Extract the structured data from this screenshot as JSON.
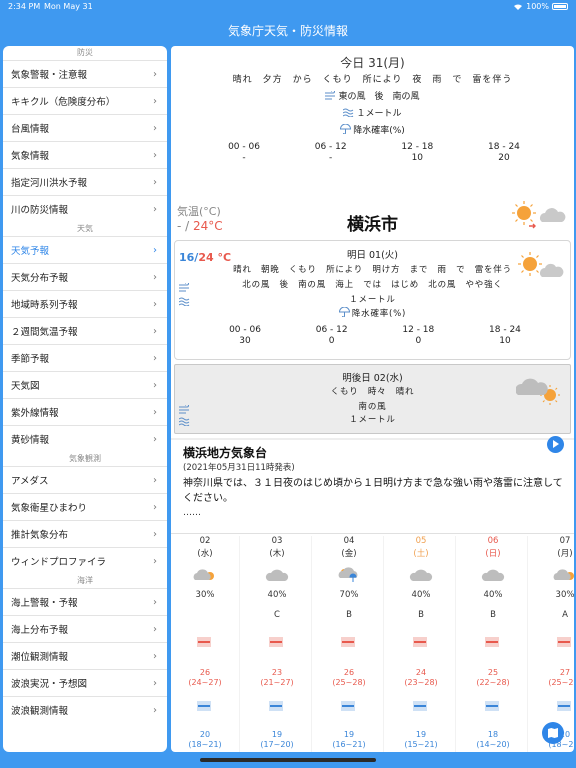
{
  "status": {
    "time": "2:34 PM",
    "date": "Mon May 31",
    "battery": "100%"
  },
  "nav": {
    "title": "気象庁天気・防災情報"
  },
  "sidebar": {
    "sections": [
      {
        "header": "防災",
        "items": [
          "気象警報・注意報",
          "キキクル（危険度分布）",
          "台風情報",
          "気象情報",
          "指定河川洪水予報",
          "川の防災情報"
        ]
      },
      {
        "header": "天気",
        "items": [
          "天気予報",
          "天気分布予報",
          "地域時系列予報",
          "２週間気温予報",
          "季節予報",
          "天気図",
          "紫外線情報",
          "黄砂情報"
        ]
      },
      {
        "header": "気象観測",
        "items": [
          "アメダス",
          "気象衛星ひまわり",
          "推計気象分布",
          "ウィンドプロファイラ"
        ]
      },
      {
        "header": "海洋",
        "items": [
          "海上警報・予報",
          "海上分布予報",
          "潮位観測情報",
          "波浪実況・予想図",
          "波浪観測情報"
        ]
      }
    ],
    "active": "天気予報",
    "chevron": "›"
  },
  "today": {
    "title": "今日  31(月)",
    "weather": "晴れ　夕方　から　くもり　所により　夜　雨　で　雷を伴う",
    "wind": "東の風　後　南の風",
    "wave": "１メートル",
    "pop_label": "降水確率(%)",
    "pop_periods": [
      "00 - 06",
      "06 - 12",
      "12 - 18",
      "18 - 24"
    ],
    "pop_values": [
      "-",
      "-",
      "10",
      "20"
    ],
    "temp_label": "気温(°C)",
    "temp_low": "- / ",
    "temp_high": "24°C",
    "city": "横浜市"
  },
  "tomorrow": {
    "title": "明日  01(火)",
    "temp_low": "16/",
    "temp_high": "24 °C",
    "weather": "晴れ　朝晩　くもり　所により　明け方　まで　雨　で　雷を伴う",
    "wind": "北の風　後　南の風　海上　では　はじめ　北の風　やや強く",
    "wave": "１メートル",
    "pop_label": "降水確率(%)",
    "pop_periods": [
      "00 - 06",
      "06 - 12",
      "12 - 18",
      "18 - 24"
    ],
    "pop_values": [
      "30",
      "0",
      "0",
      "10"
    ]
  },
  "dayafter": {
    "title": "明後日  02(水)",
    "weather": "くもり　時々　晴れ",
    "wind": "南の風",
    "wave": "１メートル"
  },
  "observatory": {
    "title": "横浜地方気象台",
    "date": "(2021年05月31日11時発表)",
    "text": "神奈川県では、３１日夜のはじめ頃から１日明け方まで急な強い雨や落雷に注意してください。",
    "more": "……"
  },
  "weekly": [
    {
      "date": "02",
      "dow": "(水)",
      "pop": "30%",
      "rel": "",
      "hi": "26",
      "hi_range": "(24~27)",
      "lo": "20",
      "lo_range": "(18~21)",
      "kind": "weekday",
      "icon": "cloud-sun-icon"
    },
    {
      "date": "03",
      "dow": "(木)",
      "pop": "40%",
      "rel": "C",
      "hi": "23",
      "hi_range": "(21~27)",
      "lo": "19",
      "lo_range": "(17~20)",
      "kind": "weekday",
      "icon": "cloud-icon"
    },
    {
      "date": "04",
      "dow": "(金)",
      "pop": "70%",
      "rel": "B",
      "hi": "26",
      "hi_range": "(25~28)",
      "lo": "19",
      "lo_range": "(16~21)",
      "kind": "weekday",
      "icon": "cloud-rain-icon"
    },
    {
      "date": "05",
      "dow": "(土)",
      "pop": "40%",
      "rel": "B",
      "hi": "24",
      "hi_range": "(23~28)",
      "lo": "19",
      "lo_range": "(15~21)",
      "kind": "sat",
      "icon": "cloud-icon"
    },
    {
      "date": "06",
      "dow": "(日)",
      "pop": "40%",
      "rel": "B",
      "hi": "25",
      "hi_range": "(22~28)",
      "lo": "18",
      "lo_range": "(14~20)",
      "kind": "sun",
      "icon": "cloud-icon"
    },
    {
      "date": "07",
      "dow": "(月)",
      "pop": "30%",
      "rel": "A",
      "hi": "27",
      "hi_range": "(25~29)",
      "lo": "20",
      "lo_range": "(18~21)",
      "kind": "weekday",
      "icon": "cloud-sun-icon"
    }
  ],
  "colors": {
    "accent": "#2f86e8",
    "header": "#3f99f0",
    "high": "#e8594d",
    "low": "#3a85d8"
  }
}
